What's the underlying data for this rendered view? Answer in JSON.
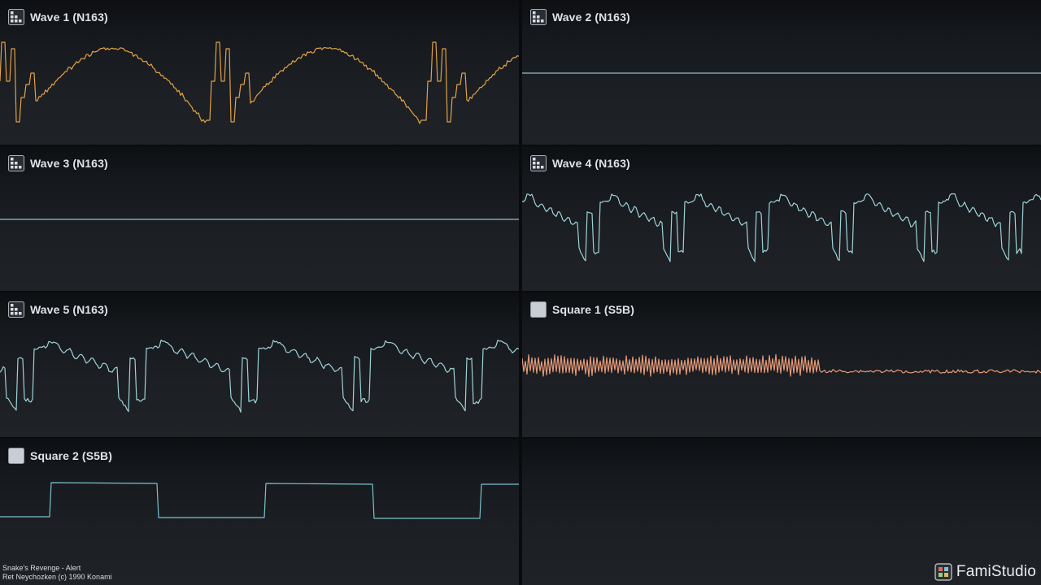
{
  "panels": [
    {
      "id": "wave1",
      "title": "Wave 1 (N163)",
      "icon": "n163-wave-channel-icon",
      "color": "#e0a24a",
      "kind": "n163a"
    },
    {
      "id": "wave2",
      "title": "Wave 2 (N163)",
      "icon": "n163-wave-channel-icon",
      "color": "#8cc4cc",
      "kind": "flat"
    },
    {
      "id": "wave3",
      "title": "Wave 3 (N163)",
      "icon": "n163-wave-channel-icon",
      "color": "#8cc4cc",
      "kind": "flat"
    },
    {
      "id": "wave4",
      "title": "Wave 4 (N163)",
      "icon": "n163-wave-channel-icon",
      "color": "#9fd3d8",
      "kind": "n163b"
    },
    {
      "id": "wave5",
      "title": "Wave 5 (N163)",
      "icon": "n163-wave-channel-icon",
      "color": "#9fd3d8",
      "kind": "n163c"
    },
    {
      "id": "square1",
      "title": "Square 1 (S5B)",
      "icon": "s5b-square-channel-icon",
      "color": "#e79a78",
      "kind": "noise"
    },
    {
      "id": "square2",
      "title": "Square 2 (S5B)",
      "icon": "s5b-square-channel-icon",
      "color": "#79c3cf",
      "kind": "square"
    },
    {
      "id": "empty",
      "title": "",
      "icon": "",
      "color": "#8cc4cc",
      "kind": "none"
    }
  ],
  "credits": {
    "song": "Snake's Revenge - Alert",
    "author": "Ret Neychozken (c) 1990 Konami"
  },
  "brand": {
    "name": "FamiStudio",
    "icon": "famistudio-logo-icon"
  }
}
